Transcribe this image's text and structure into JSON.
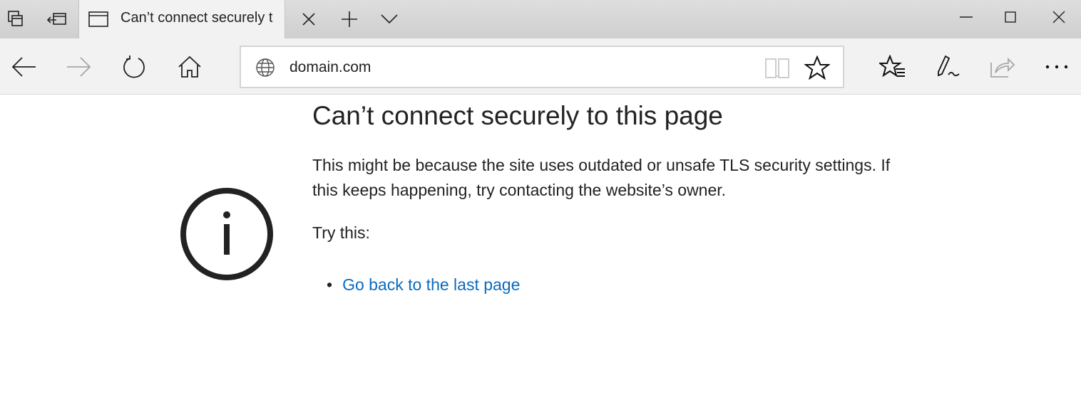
{
  "tab": {
    "title": "Can’t connect securely t"
  },
  "address": {
    "url": "domain.com"
  },
  "error": {
    "title": "Can’t connect securely to this page",
    "description": "This might be because the site uses outdated or unsafe TLS security settings. If this keeps happening, try contacting the website’s owner.",
    "try_this": "Try this:",
    "suggestions": [
      {
        "bullet": "•",
        "label": "Go back to the last page"
      }
    ]
  },
  "colors": {
    "link": "#0b6ac0",
    "toolbar": "#f2f2f2"
  }
}
